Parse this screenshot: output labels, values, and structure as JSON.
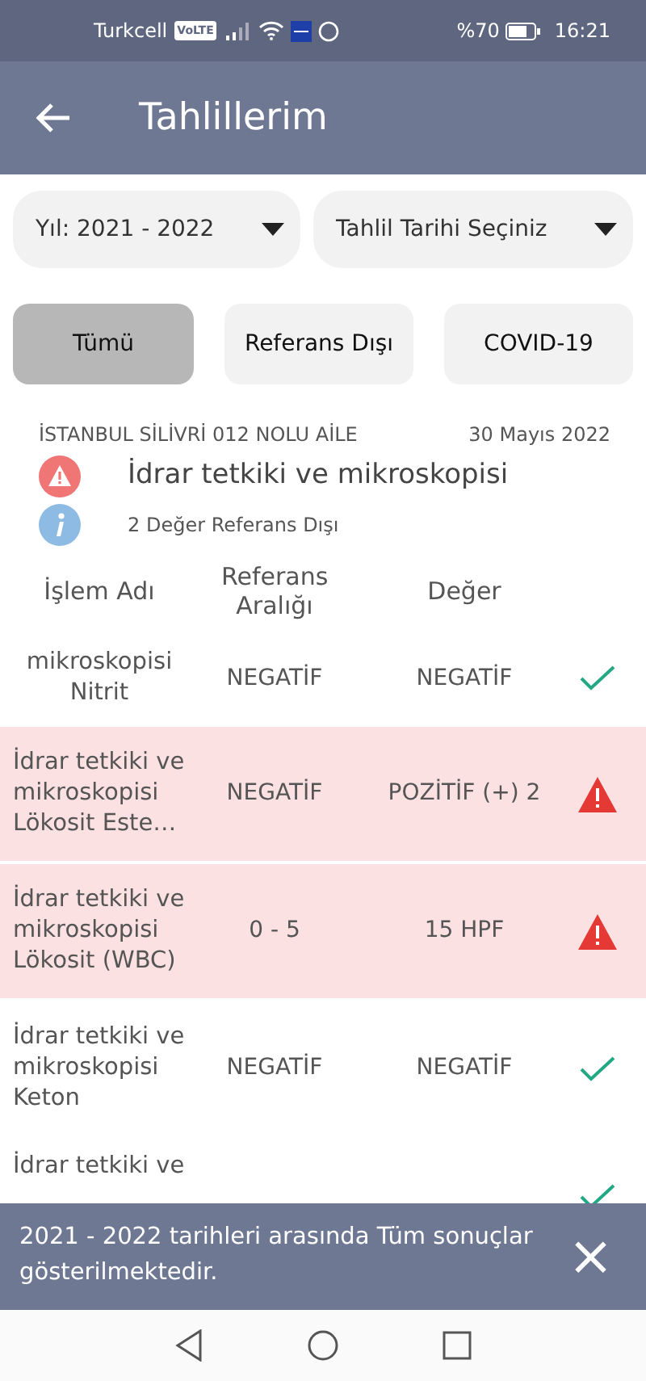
{
  "status_bar": {
    "carrier": "Turkcell",
    "volte": "VoLTE",
    "battery": "%70",
    "time": "16:21"
  },
  "app_bar": {
    "title": "Tahlillerim"
  },
  "filters": [
    {
      "label": "Yıl: 2021 - 2022"
    },
    {
      "label": "Tahlil Tarihi Seçiniz"
    }
  ],
  "tabs": [
    {
      "label": "Tümü",
      "selected": true
    },
    {
      "label": "Referans Dışı",
      "selected": false
    },
    {
      "label": "COVID-19",
      "selected": false
    }
  ],
  "result": {
    "institution": "İSTANBUL SİLİVRİ 012 NOLU AİLE",
    "date": "30 Mayıs 2022",
    "test": "İdrar tetkiki ve mikroskopisi",
    "summary": "2 Değer Referans Dışı"
  },
  "columns": [
    "İşlem Adı",
    "Referans Aralığı",
    "Değer"
  ],
  "rows": [
    {
      "name": "mikroskopisi Nitrit",
      "reference": "NEGATİF",
      "value": "NEGATİF",
      "out_of_range": false
    },
    {
      "name": "İdrar tetkiki ve mikroskopisi Lökosit Este…",
      "reference": "NEGATİF",
      "value": "POZİTİF (+) 2",
      "out_of_range": true
    },
    {
      "name": "İdrar tetkiki ve mikroskopisi Lökosit (WBC)",
      "reference": "0 - 5",
      "value": "15 HPF",
      "out_of_range": true
    },
    {
      "name": "İdrar tetkiki ve mikroskopisi Keton",
      "reference": "NEGATİF",
      "value": "NEGATİF",
      "out_of_range": false
    },
    {
      "name": "İdrar tetkiki ve",
      "out_of_range": false
    }
  ],
  "snackbar": {
    "message": "2021 - 2022 tarihleri arasında Tüm sonuçlar gösterilmektedir.",
    "close": "×"
  }
}
